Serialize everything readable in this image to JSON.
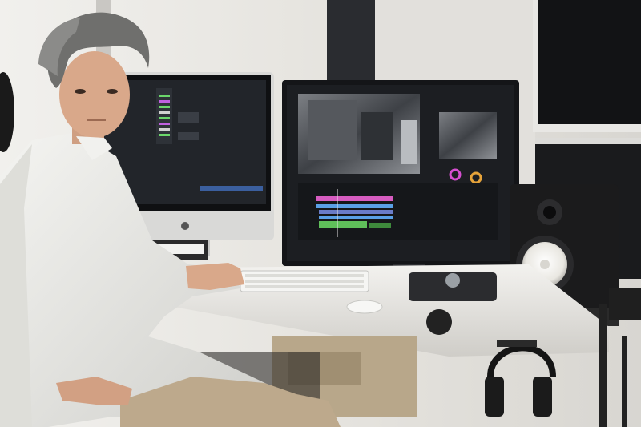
{
  "scene": {
    "description_icons": [
      "imac-monitor",
      "video-editing-monitor",
      "studio-speaker",
      "keyboard",
      "mouse",
      "audio-interface",
      "headphones",
      "microphone-stand",
      "person"
    ],
    "colors": {
      "wall": "#e9e7e3",
      "window_frame": "#2a2c30",
      "desk": "#ecebe7",
      "monitor_bezel": "#141518",
      "screen_dark": "#1c1e22",
      "imac_body": "#d9d9d7",
      "speaker": "#1b1b1c",
      "speaker_cone": "#f4f3ef",
      "shirt": "#eeeeea",
      "trousers": "#bda98c",
      "skin": "#d9a88a",
      "hair": "#6f6f6d",
      "timeline_pink": "#d65cc0",
      "timeline_green": "#5fbf5a",
      "timeline_blue": "#5aa0e6"
    }
  }
}
